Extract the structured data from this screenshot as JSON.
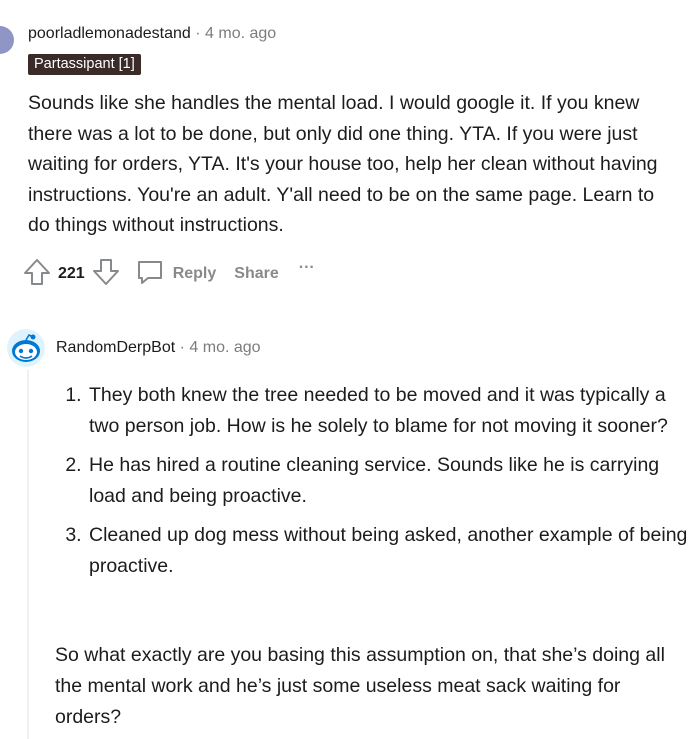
{
  "comment1": {
    "author": "poorladlemonadestand",
    "separator": "·",
    "time": "4 mo. ago",
    "flair": "Partassipant [1]",
    "body": "Sounds like she handles the mental load. I would google it. If you knew there was a lot to be done, but only did one thing. YTA. If you were just waiting for orders, YTA. It's your house too, help her clean without having instructions. You're an adult. Y'all need to be on the same page. Learn to do things without instructions.",
    "votes": "221",
    "reply_label": "Reply",
    "share_label": "Share",
    "more_label": "···"
  },
  "comment2": {
    "author": "RandomDerpBot",
    "separator": "·",
    "time": "4 mo. ago",
    "items": [
      "They both knew the tree needed to be moved and it was typically a two person job. How is he solely to blame for not moving it sooner?",
      "He has hired a routine cleaning service. Sounds like he is carrying load and being proactive.",
      "Cleaned up dog mess without being asked, another example of being proactive."
    ],
    "body": "So what exactly are you basing this assumption on, that she’s doing all the mental work and he’s just some useless meat sack waiting for orders?"
  }
}
